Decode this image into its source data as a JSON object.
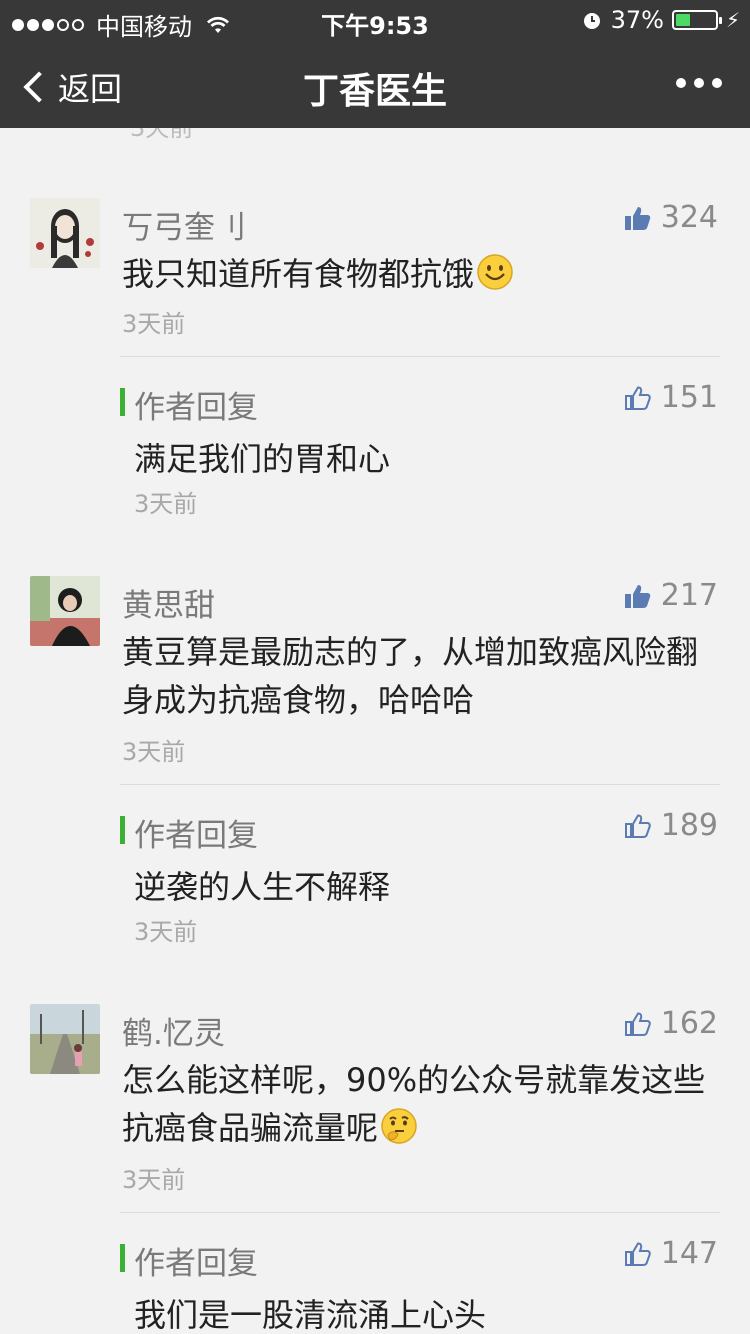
{
  "status_bar": {
    "carrier": "中国移动",
    "time": "下午9:53",
    "battery": "37%",
    "battery_level": 0.37
  },
  "nav": {
    "back_label": "返回",
    "title": "丁香医生"
  },
  "faded_time": "3天前",
  "comments": [
    {
      "name": "丂弓奎刂",
      "likes": "324",
      "text": "我只知道所有食物都抗饿",
      "time": "3天前",
      "reply": {
        "label": "作者回复",
        "likes": "151",
        "text": "满足我们的胃和心",
        "time": "3天前"
      }
    },
    {
      "name": "黄思甜",
      "likes": "217",
      "text": "黄豆算是最励志的了，从增加致癌风险翻身成为抗癌食物，哈哈哈",
      "time": "3天前",
      "reply": {
        "label": "作者回复",
        "likes": "189",
        "text": "逆袭的人生不解释",
        "time": "3天前"
      }
    },
    {
      "name": "鹤.忆灵",
      "likes": "162",
      "text": "怎么能这样呢，90%的公众号就靠发这些抗癌食品骗流量呢",
      "time": "3天前",
      "reply": {
        "label": "作者回复",
        "likes": "147",
        "text": "我们是一股清流涌上心头",
        "time": ""
      }
    }
  ],
  "icons": {
    "like_solid": "thumbs-up-filled-icon",
    "like_outline": "thumbs-up-outline-icon",
    "smile": "smile-emoji-icon",
    "think": "thinking-emoji-icon"
  },
  "colors": {
    "nav_bg": "#383838",
    "reply_bar": "#3cb034",
    "like_icon": "#5b7bb3"
  }
}
